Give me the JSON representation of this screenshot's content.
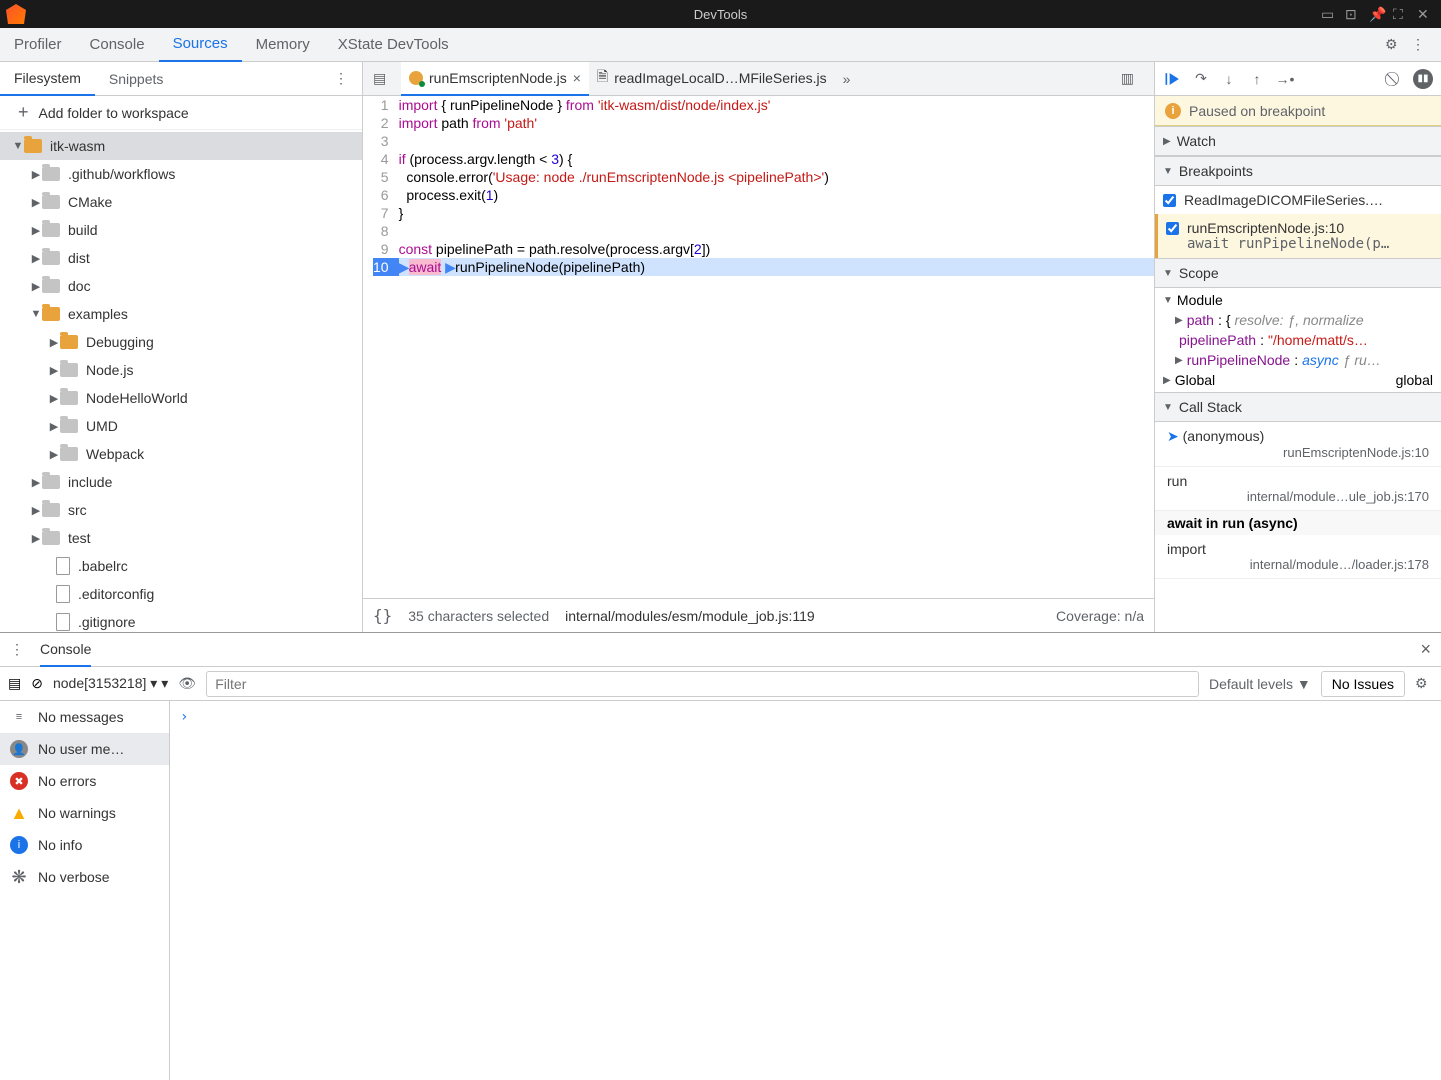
{
  "window": {
    "title": "DevTools"
  },
  "main_tabs": [
    "Profiler",
    "Console",
    "Sources",
    "Memory",
    "XState DevTools"
  ],
  "main_tab_active": 2,
  "left": {
    "tabs": [
      "Filesystem",
      "Snippets"
    ],
    "tab_active": 0,
    "add_folder": "Add folder to workspace",
    "tree": [
      {
        "depth": 0,
        "exp": "▼",
        "kind": "folder-open",
        "label": "itk-wasm",
        "sel": true
      },
      {
        "depth": 1,
        "exp": "▶",
        "kind": "folder",
        "label": ".github/workflows"
      },
      {
        "depth": 1,
        "exp": "▶",
        "kind": "folder",
        "label": "CMake"
      },
      {
        "depth": 1,
        "exp": "▶",
        "kind": "folder",
        "label": "build"
      },
      {
        "depth": 1,
        "exp": "▶",
        "kind": "folder",
        "label": "dist"
      },
      {
        "depth": 1,
        "exp": "▶",
        "kind": "folder",
        "label": "doc"
      },
      {
        "depth": 1,
        "exp": "▼",
        "kind": "folder-open",
        "label": "examples"
      },
      {
        "depth": 2,
        "exp": "▶",
        "kind": "folder-open",
        "label": "Debugging"
      },
      {
        "depth": 2,
        "exp": "▶",
        "kind": "folder",
        "label": "Node.js"
      },
      {
        "depth": 2,
        "exp": "▶",
        "kind": "folder",
        "label": "NodeHelloWorld"
      },
      {
        "depth": 2,
        "exp": "▶",
        "kind": "folder",
        "label": "UMD"
      },
      {
        "depth": 2,
        "exp": "▶",
        "kind": "folder",
        "label": "Webpack"
      },
      {
        "depth": 1,
        "exp": "▶",
        "kind": "folder",
        "label": "include"
      },
      {
        "depth": 1,
        "exp": "▶",
        "kind": "folder",
        "label": "src"
      },
      {
        "depth": 1,
        "exp": "▶",
        "kind": "folder",
        "label": "test"
      },
      {
        "depth": 1,
        "exp": "",
        "kind": "file",
        "label": ".babelrc"
      },
      {
        "depth": 1,
        "exp": "",
        "kind": "file",
        "label": ".editorconfig"
      },
      {
        "depth": 1,
        "exp": "",
        "kind": "file",
        "label": ".gitignore"
      }
    ]
  },
  "editor": {
    "tabs": [
      {
        "label": "runEmscriptenNode.js",
        "active": true,
        "dirty": true
      },
      {
        "label": "readImageLocalD…MFileSeries.js",
        "active": false,
        "dirty": false
      }
    ],
    "lines": [
      {
        "n": 1,
        "tok": [
          [
            "kw",
            "import"
          ],
          [
            "",
            " { runPipelineNode } "
          ],
          [
            "kw",
            "from"
          ],
          [
            "",
            " "
          ],
          [
            "str",
            "'itk-wasm/dist/node/index.js'"
          ]
        ]
      },
      {
        "n": 2,
        "tok": [
          [
            "kw",
            "import"
          ],
          [
            "",
            " path "
          ],
          [
            "kw",
            "from"
          ],
          [
            "",
            " "
          ],
          [
            "str",
            "'path'"
          ]
        ]
      },
      {
        "n": 3,
        "tok": [
          [
            "",
            ""
          ]
        ]
      },
      {
        "n": 4,
        "tok": [
          [
            "kw",
            "if"
          ],
          [
            "",
            " (process"
          ],
          [
            "",
            ".argv.length < "
          ],
          [
            "num",
            "3"
          ],
          [
            "",
            ") {"
          ]
        ]
      },
      {
        "n": 5,
        "tok": [
          [
            "",
            "  console"
          ],
          [
            "",
            ".error("
          ],
          [
            "str",
            "'Usage: node ./runEmscriptenNode.js <pipelinePath>'"
          ],
          [
            "",
            ")"
          ]
        ]
      },
      {
        "n": 6,
        "tok": [
          [
            "",
            "  process"
          ],
          [
            "",
            ".exit("
          ],
          [
            "num",
            "1"
          ],
          [
            "",
            ")"
          ]
        ]
      },
      {
        "n": 7,
        "tok": [
          [
            "",
            "}"
          ]
        ]
      },
      {
        "n": 8,
        "tok": [
          [
            "",
            ""
          ]
        ]
      },
      {
        "n": 9,
        "tok": [
          [
            "kw",
            "const"
          ],
          [
            "",
            " pipelinePath = path"
          ],
          [
            "",
            ".resolve(process.argv["
          ],
          [
            "num",
            "2"
          ],
          [
            "",
            "])"
          ]
        ]
      },
      {
        "n": 10,
        "bp": true,
        "exec": true,
        "tok": [
          [
            "marker",
            "▶"
          ],
          [
            "hl-await",
            "await"
          ],
          [
            "",
            " "
          ],
          [
            "marker",
            "▶"
          ],
          [
            "",
            "runPipelineNode(pipelinePath)"
          ]
        ]
      }
    ],
    "status": {
      "braces": "{}",
      "selection": "35 characters selected",
      "location": "internal/modules/esm/module_job.js:119",
      "coverage": "Coverage: n/a"
    }
  },
  "debug": {
    "paused": "Paused on breakpoint",
    "sections": {
      "watch": "Watch",
      "breakpoints": "Breakpoints",
      "scope": "Scope",
      "callstack": "Call Stack"
    },
    "breakpoints": [
      {
        "checked": true,
        "loc": "ReadImageDICOMFileSeries.…",
        "code": "",
        "highlight": false
      },
      {
        "checked": true,
        "loc": "runEmscriptenNode.js:10",
        "code": "await runPipelineNode(p…",
        "highlight": true
      }
    ],
    "scope": {
      "module_label": "Module",
      "rows": [
        {
          "exp": "▶",
          "prop": "path",
          "sep": ": ",
          "val": "{",
          "extra": "resolve: ƒ, normalize"
        },
        {
          "exp": "",
          "prop": "pipelinePath",
          "sep": ": ",
          "valstr": "\"/home/matt/s…"
        },
        {
          "exp": "▶",
          "prop": "runPipelineNode",
          "sep": ": ",
          "valkw": "async",
          "valfn": " ƒ ru…"
        }
      ],
      "global_label": "Global",
      "global_val": "global"
    },
    "callstack": [
      {
        "name": "(anonymous)",
        "loc": "runEmscriptenNode.js:10",
        "current": true
      },
      {
        "name": "run",
        "loc": "internal/module…ule_job.js:170"
      },
      {
        "async": "await in run (async)"
      },
      {
        "name": "import",
        "loc": "internal/module…/loader.js:178"
      }
    ]
  },
  "console": {
    "tab": "Console",
    "context": "node[3153218]",
    "filter_placeholder": "Filter",
    "levels": "Default levels",
    "issues": "No Issues",
    "sidebar": [
      {
        "icon": "lines",
        "label": "No messages"
      },
      {
        "icon": "user",
        "label": "No user me…",
        "sel": true
      },
      {
        "icon": "err",
        "label": "No errors"
      },
      {
        "icon": "warn",
        "label": "No warnings"
      },
      {
        "icon": "info",
        "label": "No info"
      },
      {
        "icon": "verb",
        "label": "No verbose"
      }
    ],
    "prompt": "›"
  }
}
